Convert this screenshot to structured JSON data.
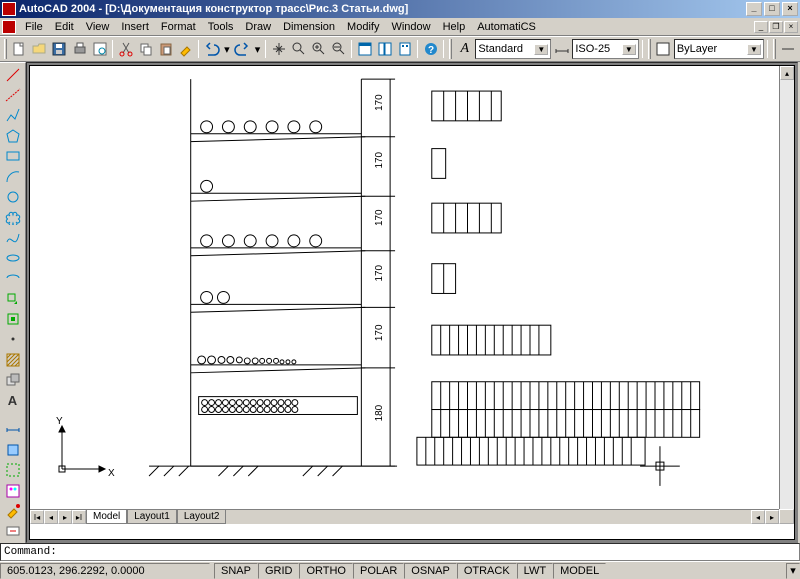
{
  "titlebar": {
    "app": "AutoCAD 2004",
    "path": "[D:\\Документация конструктор трасс\\Рис.3 Статьи.dwg]"
  },
  "menu": {
    "file": "File",
    "edit": "Edit",
    "view": "View",
    "insert": "Insert",
    "format": "Format",
    "tools": "Tools",
    "draw": "Draw",
    "dimension": "Dimension",
    "modify": "Modify",
    "window": "Window",
    "help": "Help",
    "autics": "AutomatiCS"
  },
  "styles": {
    "font_label": "A",
    "textstyle": "Standard",
    "dimstyle": "ISO-25",
    "layer": "ByLayer"
  },
  "tabs": {
    "model": "Model",
    "layout1": "Layout1",
    "layout2": "Layout2"
  },
  "command": {
    "prompt": "Command:"
  },
  "status": {
    "coords": "605.0123, 296.2292, 0.0000",
    "snap": "SNAP",
    "grid": "GRID",
    "ortho": "ORTHO",
    "polar": "POLAR",
    "osnap": "OSNAP",
    "otrack": "OTRACK",
    "lwt": "LWT",
    "model": "MODEL"
  },
  "drawing": {
    "shelf_labels": [
      "170",
      "170",
      "170",
      "170",
      "170",
      "180"
    ],
    "axis_x": "X",
    "axis_y": "Y"
  }
}
